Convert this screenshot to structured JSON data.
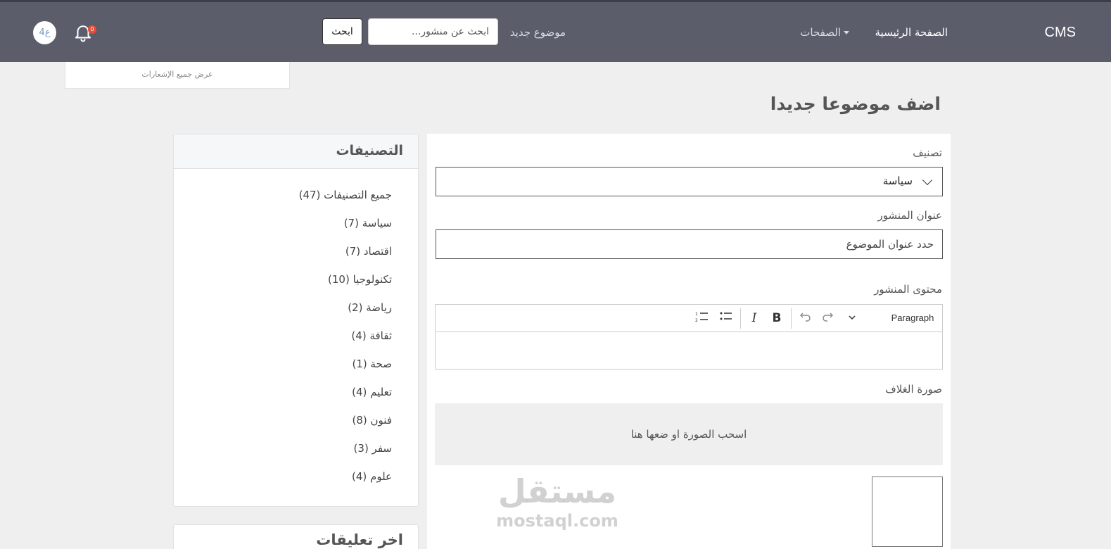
{
  "navbar": {
    "brand": "CMS",
    "home": "الصفحة الرئيسية",
    "pages": "الصفحات",
    "new_topic": "موضوع جديد",
    "search_placeholder": "ابحث عن منشور...",
    "search_button": "ابحث",
    "notification_count": "0",
    "avatar_text": "ع4"
  },
  "notifications": {
    "view_all": "عرض جميع الإشعارات"
  },
  "page": {
    "title": "اضف موضوعا جديدا"
  },
  "form": {
    "category_label": "تصنيف",
    "category_value": "سياسة",
    "title_label": "عنوان المنشور",
    "title_placeholder": "حدد عنوان الموضوع",
    "content_label": "محتوى المنشور",
    "toolbar": {
      "paragraph": "Paragraph",
      "bold": "B",
      "italic": "I"
    },
    "cover_label": "صورة الغلاف",
    "dropzone_text": "اسحب الصورة او ضعها هنا"
  },
  "categories": {
    "title": "التصنيفات",
    "items": [
      "جميع التصنيفات (47)",
      "سياسة (7)",
      "اقتصاد (7)",
      "تكنولوجيا (10)",
      "رياضة (2)",
      "ثقافة (4)",
      "صحة (1)",
      "تعليم (4)",
      "فنون (8)",
      "سفر (3)",
      "علوم (4)"
    ]
  },
  "comments": {
    "title": "اخر تعليقات"
  },
  "watermark": {
    "arabic": "مستقل",
    "latin": "mostaql.com"
  }
}
